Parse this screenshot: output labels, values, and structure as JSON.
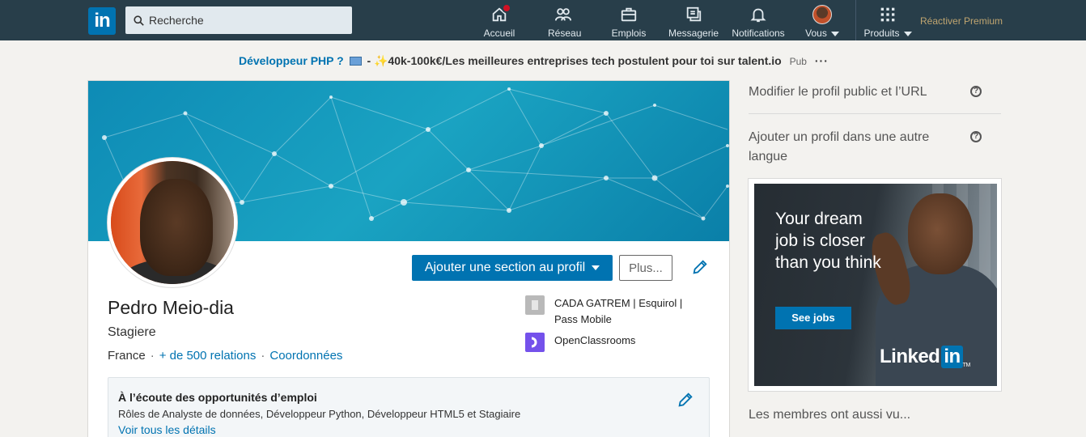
{
  "nav": {
    "logo_text": "in",
    "search_placeholder": "Recherche",
    "items": [
      {
        "label": "Accueil",
        "icon": "home-icon",
        "badge": true
      },
      {
        "label": "Réseau",
        "icon": "network-icon"
      },
      {
        "label": "Emplois",
        "icon": "briefcase-icon"
      },
      {
        "label": "Messagerie",
        "icon": "messaging-icon"
      },
      {
        "label": "Notifications",
        "icon": "bell-icon"
      },
      {
        "label": "Vous",
        "icon": "avatar"
      },
      {
        "label": "Produits",
        "icon": "grid-icon"
      }
    ],
    "premium": "Réactiver Premium"
  },
  "ad_banner": {
    "part1": "Développeur PHP ?",
    "part2": "-",
    "part3": "40k-100k€/Les meilleures entreprises tech postulent pour toi sur talent.io",
    "pub": "Pub",
    "more": "···"
  },
  "profile": {
    "add_section_button": "Ajouter une section au profil",
    "more_button": "Plus...",
    "name": "Pedro Meio-dia",
    "headline": "Stagiere",
    "location": "France",
    "relations": "+ de 500 relations",
    "contact": "Coordonnées",
    "experience": [
      {
        "name": "CADA GATREM | Esquirol | Pass Mobile",
        "logo": "building-icon"
      },
      {
        "name": "OpenClassrooms",
        "logo": "openclassrooms-icon"
      }
    ],
    "opportunities": {
      "title": "À l’écoute des opportunités d’emploi",
      "desc": "Rôles de Analyste de données, Développeur Python, Développeur HTML5 et Stagiaire",
      "link": "Voir tous les détails"
    }
  },
  "rail": {
    "public_profile": "Modifier le profil public et l’URL",
    "other_language": "Ajouter un profil dans une autre langue",
    "ad": {
      "headline": "Your dream job is closer than you think",
      "button": "See jobs",
      "brand": "Linked",
      "brand_in": "in"
    },
    "members_viewed": "Les membres ont aussi vu..."
  },
  "colors": {
    "nav_bg": "#283e4a",
    "primary": "#0073b1",
    "premium": "#c0a570",
    "page_bg": "#f3f2ef"
  }
}
